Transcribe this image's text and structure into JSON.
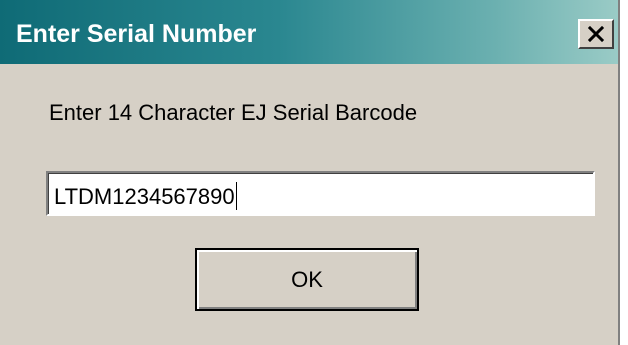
{
  "dialog": {
    "title": "Enter Serial Number",
    "prompt": "Enter 14 Character EJ Serial Barcode",
    "serial_value": "LTDM1234567890",
    "ok_label": "OK",
    "close_icon": "close-icon"
  },
  "colors": {
    "title_gradient_start": "#0f6b76",
    "title_gradient_end": "#9acbc6",
    "dialog_background": "#d6d0c6",
    "input_background": "#ffffff"
  }
}
